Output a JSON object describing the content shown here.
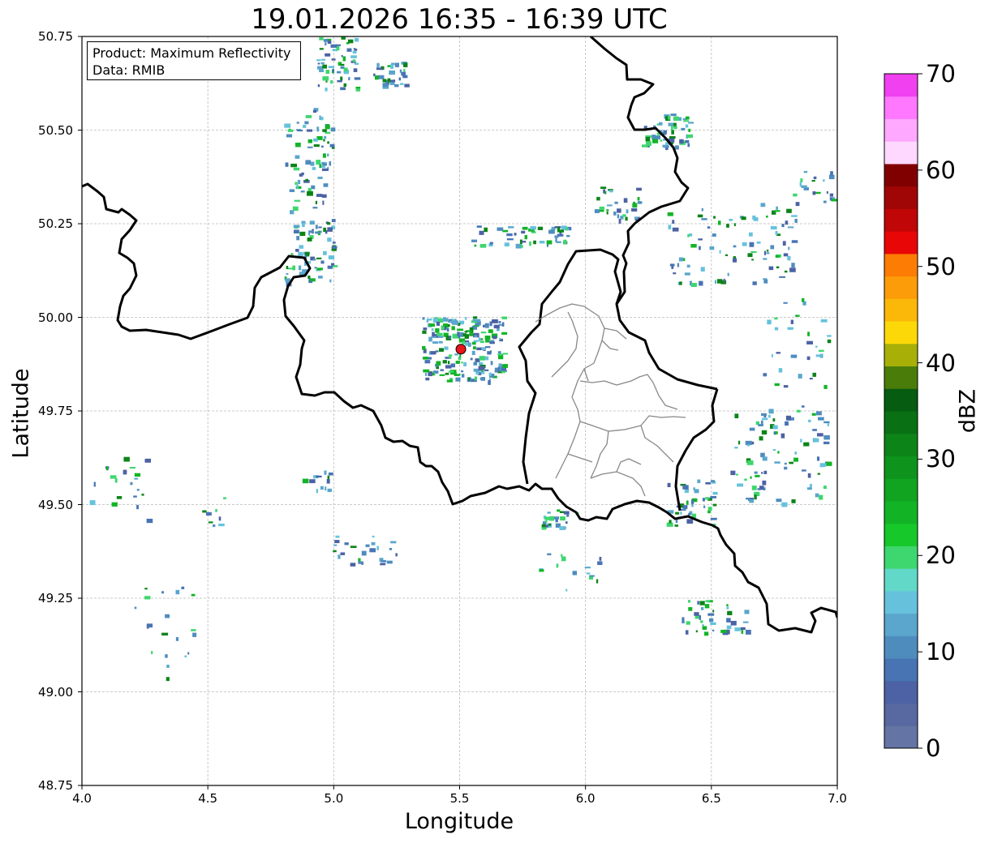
{
  "chart_data": {
    "type": "heatmap",
    "title": "19.01.2026 16:35 - 16:39 UTC",
    "xlabel": "Longitude",
    "ylabel": "Latitude",
    "xlim": [
      4.0,
      7.0
    ],
    "ylim": [
      48.75,
      50.75
    ],
    "xticks": [
      "4.0",
      "4.5",
      "5.0",
      "5.5",
      "6.0",
      "6.5",
      "7.0"
    ],
    "yticks": [
      "50.75",
      "50.50",
      "50.25",
      "50.00",
      "49.75",
      "49.50",
      "49.25",
      "49.00",
      "48.75"
    ],
    "grid": true,
    "annotation": {
      "line1": "Product: Maximum Reflectivity",
      "line2": "Data: RMIB"
    },
    "radar_site": {
      "lon": 5.505,
      "lat": 49.915,
      "color": "#e8151b"
    },
    "colorbar": {
      "label": "dBZ",
      "min": 0,
      "max": 70,
      "ticks": [
        "0",
        "10",
        "20",
        "30",
        "40",
        "50",
        "60",
        "70"
      ],
      "colors": [
        "#6474a4",
        "#5868a0",
        "#4c62a4",
        "#4874b4",
        "#4f8cbe",
        "#5aa6cc",
        "#66c2dc",
        "#62d8c8",
        "#3ed66e",
        "#16c82a",
        "#12b426",
        "#10a420",
        "#0e941c",
        "#0c8418",
        "#0a7014",
        "#065c10",
        "#4a7c0a",
        "#a8b008",
        "#fcd808",
        "#fcb808",
        "#fc9c08",
        "#fc7c04",
        "#e80606",
        "#c00606",
        "#a00606",
        "#800000",
        "#ffd8ff",
        "#ffa8ff",
        "#ff78ff",
        "#f040f0"
      ]
    }
  }
}
